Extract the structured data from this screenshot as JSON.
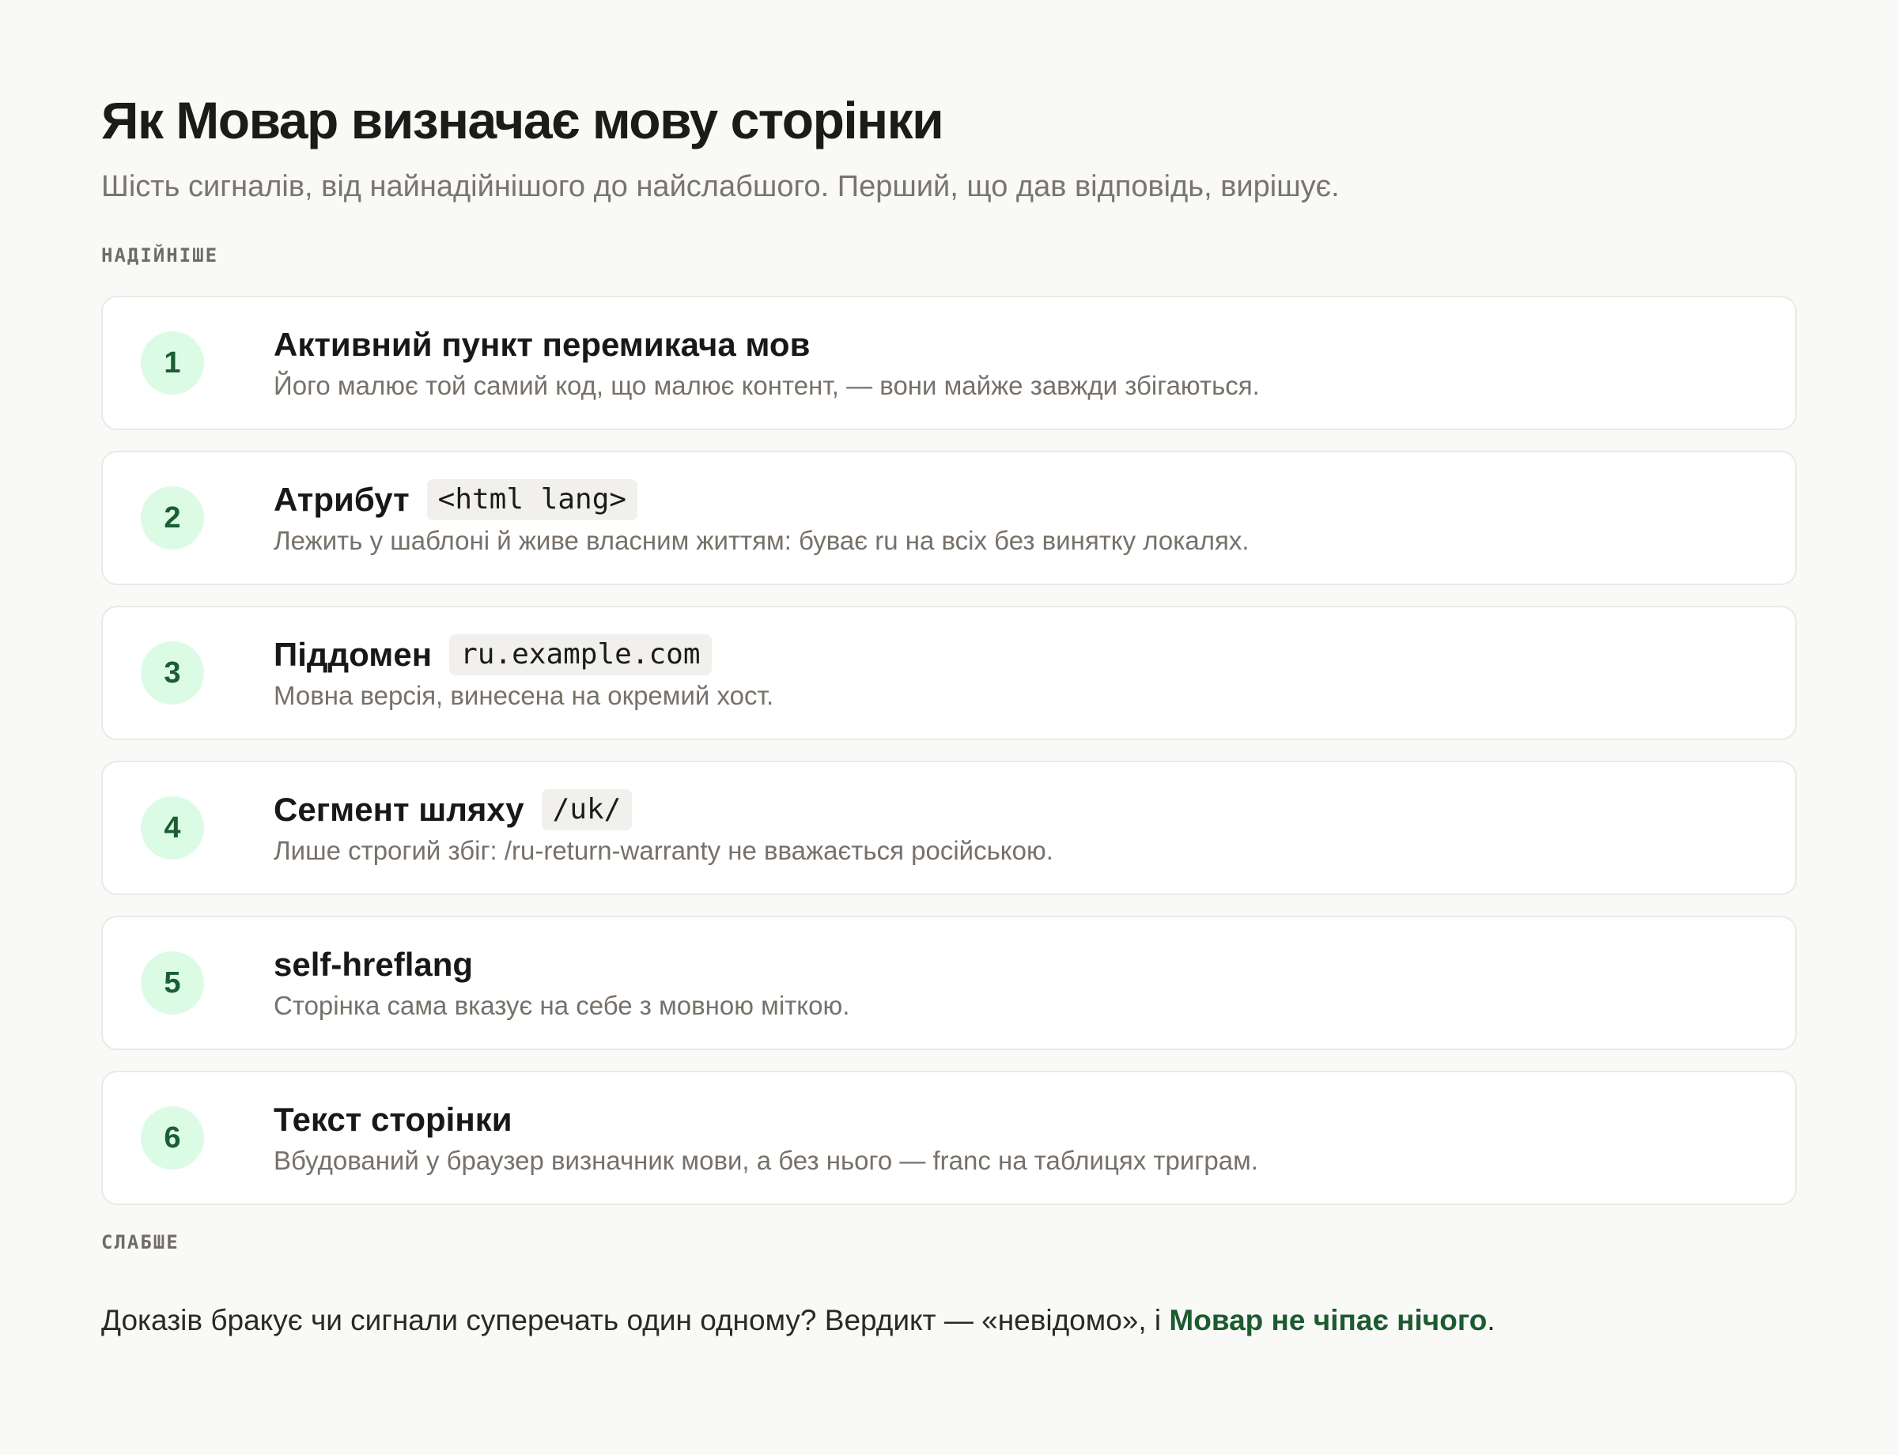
{
  "header": {
    "title": "Як Мовар визначає мову сторінки",
    "subtitle": "Шість сигналів, від найнадійнішого до найслабшого. Перший, що дав відповідь, вирішує."
  },
  "labels": {
    "top": "НАДІЙНІШЕ",
    "bottom": "СЛАБШЕ"
  },
  "signals": [
    {
      "number": "1",
      "title": "Активний пункт перемикача мов",
      "code": "",
      "description": "Його малює той самий код, що малює контент, — вони майже завжди збігаються."
    },
    {
      "number": "2",
      "title": "Атрибут",
      "code": "<html lang>",
      "description": "Лежить у шаблоні й живе власним життям: буває ru на всіх без винятку локалях."
    },
    {
      "number": "3",
      "title": "Піддомен",
      "code": "ru.example.com",
      "description": "Мовна версія, винесена на окремий хост."
    },
    {
      "number": "4",
      "title": "Сегмент шляху",
      "code": "/uk/",
      "description": "Лише строгий збіг: /ru-return-warranty не вважається російською."
    },
    {
      "number": "5",
      "title": "self-hreflang",
      "code": "",
      "description": "Сторінка сама вказує на себе з мовною міткою."
    },
    {
      "number": "6",
      "title": "Текст сторінки",
      "code": "",
      "description": "Вбудований у браузер визначник мови, а без нього — franc на таблицях триграм."
    }
  ],
  "verdict": {
    "text": "Доказів бракує чи сигнали суперечать один одному? Вердикт — «невідомо», і ",
    "emphasis": "Мовар не чіпає нічого",
    "end": "."
  },
  "colors": {
    "accent": "#1d5a30",
    "badge_bg": "#dcfbe5",
    "background": "#f9f9f7"
  }
}
